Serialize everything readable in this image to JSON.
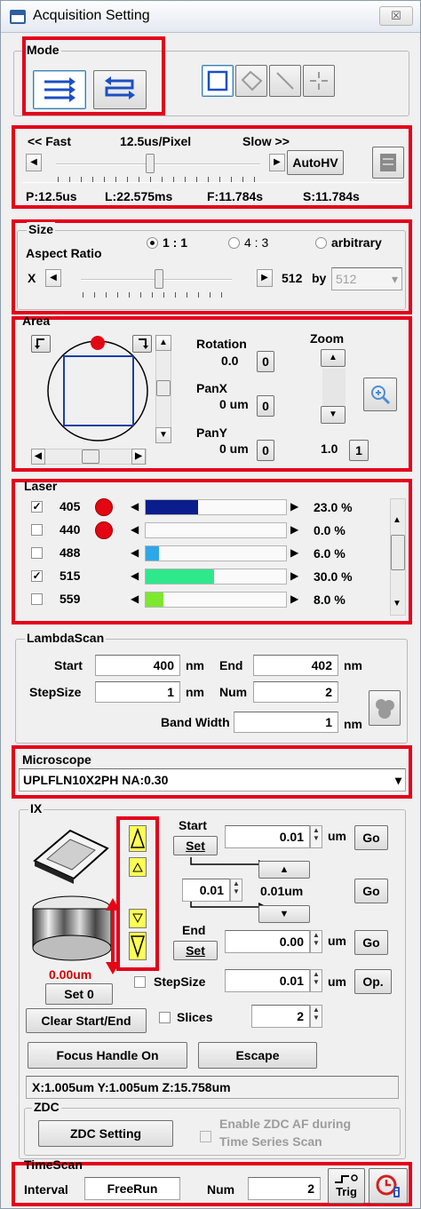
{
  "window": {
    "title": "Acquisition Setting",
    "close_glyph": "☒"
  },
  "mode": {
    "label": "Mode",
    "buttons": [
      "one-way-scan-icon",
      "round-trip-scan-icon"
    ],
    "roi_tools": [
      "rectangle-roi-icon",
      "polygon-roi-icon",
      "line-roi-icon",
      "point-roi-icon"
    ]
  },
  "speed": {
    "fast_label": "<< Fast",
    "value_label": "12.5us/Pixel",
    "slow_label": "Slow >>",
    "autohv_label": "AutoHV",
    "position": 0.46,
    "stats": {
      "p": "P:12.5us",
      "l": "L:22.575ms",
      "f": "F:11.784s",
      "s": "S:11.784s"
    }
  },
  "size": {
    "label": "Size",
    "aspect_label": "Aspect Ratio",
    "options": [
      "1 : 1",
      "4 : 3",
      "arbitrary"
    ],
    "selected": "1 : 1",
    "x_label": "X",
    "x_value": "512",
    "by_label": "by",
    "y_value": "512",
    "slider_position": 0.52
  },
  "area": {
    "label": "Area",
    "rotation_label": "Rotation",
    "rotation_value": "0.0",
    "rotation_reset": "0",
    "panx_label": "PanX",
    "panx_value": "0 um",
    "panx_reset": "0",
    "pany_label": "PanY",
    "pany_value": "0 um",
    "pany_reset": "0",
    "zoom_label": "Zoom",
    "zoom_value": "1.0",
    "zoom_reset": "1"
  },
  "laser": {
    "label": "Laser",
    "rows": [
      {
        "checked": true,
        "wavelength": "405",
        "dot": true,
        "percent": 23.0,
        "percent_label": "23.0 %",
        "color": "#0a1d8c"
      },
      {
        "checked": false,
        "wavelength": "440",
        "dot": true,
        "percent": 0.0,
        "percent_label": "0.0 %",
        "color": "#1a3aa8"
      },
      {
        "checked": false,
        "wavelength": "488",
        "dot": false,
        "percent": 6.0,
        "percent_label": "6.0 %",
        "color": "#2ea7e8"
      },
      {
        "checked": true,
        "wavelength": "515",
        "dot": false,
        "percent": 30.0,
        "percent_label": "30.0 %",
        "color": "#2ee88c"
      },
      {
        "checked": false,
        "wavelength": "559",
        "dot": false,
        "percent": 8.0,
        "percent_label": "8.0 %",
        "color": "#7ce82e"
      }
    ]
  },
  "lambda": {
    "label": "LambdaScan",
    "start_label": "Start",
    "start_value": "400",
    "start_unit": "nm",
    "end_label": "End",
    "end_value": "402",
    "end_unit": "nm",
    "step_label": "StepSize",
    "step_value": "1",
    "step_unit": "nm",
    "num_label": "Num",
    "num_value": "2",
    "bw_label": "Band Width",
    "bw_value": "1",
    "bw_unit": "nm"
  },
  "microscope": {
    "label": "Microscope",
    "objective": "UPLFLN10X2PH  NA:0.30"
  },
  "ix": {
    "label": "IX",
    "start_label": "Start",
    "start_set": "Set",
    "start_value": "0.01",
    "start_unit": "um",
    "start_go": "Go",
    "step_value": "0.01",
    "step_display": "0.01um",
    "step_go": "Go",
    "end_label": "End",
    "end_set": "Set",
    "end_value": "0.00",
    "end_unit": "um",
    "end_go": "Go",
    "current_pos": "0.00um",
    "set0": "Set 0",
    "stepsize_label": "StepSize",
    "stepsize_value": "0.01",
    "stepsize_unit": "um",
    "op_label": "Op.",
    "clear_label": "Clear Start/End",
    "slices_label": "Slices",
    "slices_value": "2",
    "focus_handle_label": "Focus Handle On",
    "escape_label": "Escape",
    "position_readout": "X:1.005um Y:1.005um Z:15.758um"
  },
  "zdc": {
    "label": "ZDC",
    "setting_label": "ZDC Setting",
    "enable_label_1": "Enable ZDC AF during",
    "enable_label_2": "Time Series Scan"
  },
  "timescan": {
    "label": "TimeScan",
    "interval_label": "Interval",
    "interval_value": "FreeRun",
    "num_label": "Num",
    "num_value": "2",
    "trig_label": "Trig"
  }
}
